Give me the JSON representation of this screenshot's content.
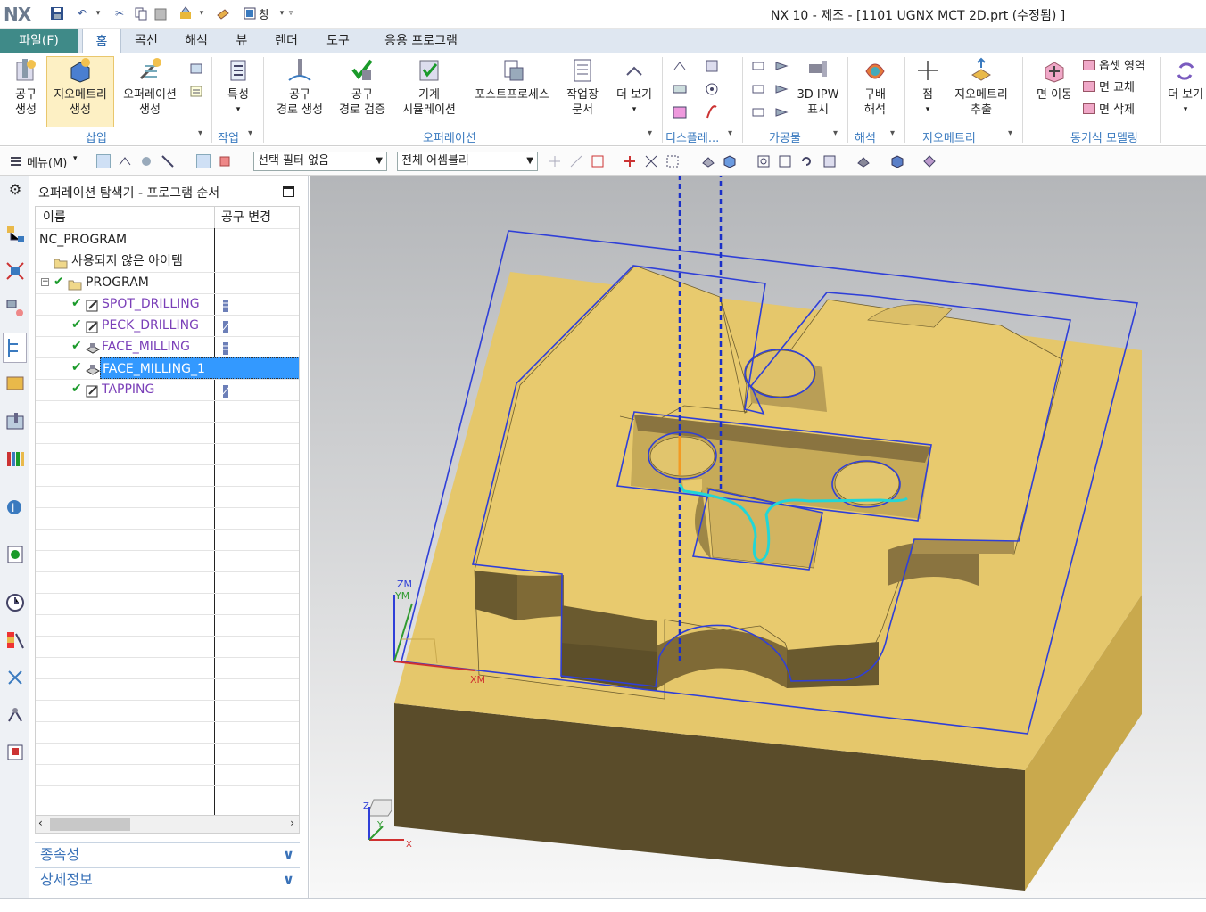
{
  "app": {
    "logo": "NX",
    "window_title": "NX 10 - 제조 - [1101 UGNX MCT 2D.prt (수정됨) ]",
    "quick_access": {
      "window_menu": "창"
    }
  },
  "tabs": {
    "file": "파일(F)",
    "items": [
      "홈",
      "곡선",
      "해석",
      "뷰",
      "렌더",
      "도구",
      "응용 프로그램"
    ],
    "active": "홈"
  },
  "ribbon": {
    "insert": {
      "tool_create_l1": "공구",
      "tool_create_l2": "생성",
      "geometry_create_l1": "지오메트리",
      "geometry_create_l2": "생성",
      "operation_create_l1": "오퍼레이션",
      "operation_create_l2": "생성",
      "group": "삽입"
    },
    "work": {
      "properties": "특성",
      "group": "작업"
    },
    "operation": {
      "path_create_l1": "공구",
      "path_create_l2": "경로 생성",
      "path_verify_l1": "공구",
      "path_verify_l2": "경로 검증",
      "machine_sim_l1": "기계",
      "machine_sim_l2": "시뮬레이션",
      "postprocess": "포스트프로세스",
      "shop_doc_l1": "작업장",
      "shop_doc_l2": "문서",
      "more": "더 보기",
      "group": "오퍼레이션"
    },
    "display": {
      "group": "디스플레..."
    },
    "workpiece": {
      "ipw_l1": "3D IPW",
      "ipw_l2": "표시",
      "group": "가공물"
    },
    "analysis": {
      "slope_l1": "구배",
      "slope_l2": "해석",
      "group": "해석"
    },
    "geometry": {
      "point": "점",
      "extract_l1": "지오메트리",
      "extract_l2": "추출",
      "group": "지오메트리"
    },
    "sync": {
      "move_face": "면 이동",
      "offset_region": "옵셋 영역",
      "replace_face": "면 교체",
      "delete_face": "면 삭제",
      "group": "동기식 모델링"
    },
    "more_right": "더 보기"
  },
  "cmdbar": {
    "menu": "메뉴(M)",
    "filter": "선택 필터 없음",
    "assembly": "전체 어셈블리"
  },
  "navigator": {
    "title": "오퍼레이션 탐색기 - 프로그램 순서",
    "col_name": "이름",
    "col_tool_change": "공구 변경",
    "rows": [
      {
        "label": "NC_PROGRAM"
      },
      {
        "label": "사용되지 않은 아이템"
      },
      {
        "label": "PROGRAM"
      },
      {
        "label": "SPOT_DRILLING"
      },
      {
        "label": "PECK_DRILLING"
      },
      {
        "label": "FACE_MILLING"
      },
      {
        "label": "FACE_MILLING_1"
      },
      {
        "label": "TAPPING"
      }
    ],
    "selected": "FACE_MILLING_1",
    "dependencies": "종속성",
    "details": "상세정보"
  },
  "viewport": {
    "mcs_z": "ZM",
    "mcs_y": "YM",
    "mcs_x": "XM",
    "triad_z": "Z",
    "triad_y": "Y",
    "triad_x": "X"
  },
  "colors": {
    "part_top": "#e5c76b",
    "part_side": "#c9a94d",
    "part_dark": "#5a4c2a",
    "boundary": "#2f3fd8",
    "toolpath": "#22d6d6",
    "selection": "#3399ff",
    "file_tab": "#3f8a88"
  }
}
